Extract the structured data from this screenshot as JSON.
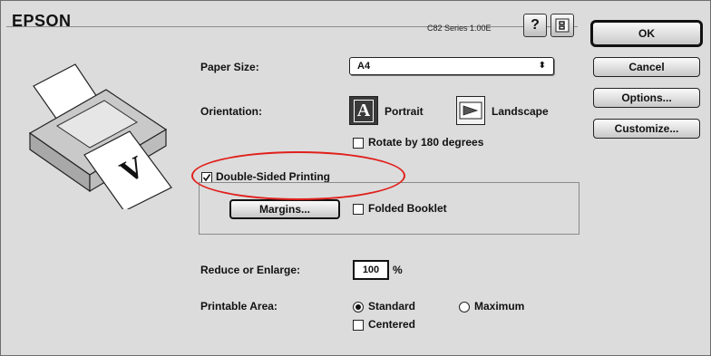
{
  "header": {
    "brand": "EPSON",
    "version": "C82 Series 1.00E",
    "help_label": "?"
  },
  "buttons": {
    "ok": "OK",
    "cancel": "Cancel",
    "options": "Options...",
    "customize": "Customize..."
  },
  "paper_size": {
    "label": "Paper Size:",
    "value": "A4"
  },
  "orientation": {
    "label": "Orientation:",
    "portrait_label": "Portrait",
    "landscape_label": "Landscape",
    "selected": "Portrait",
    "portrait_glyph": "A"
  },
  "rotate": {
    "label": "Rotate by 180 degrees",
    "checked": false
  },
  "double_sided": {
    "label": "Double-Sided Printing",
    "checked": true,
    "margins_label": "Margins...",
    "folded_booklet_label": "Folded Booklet",
    "folded_booklet_checked": false
  },
  "reduce_enlarge": {
    "label": "Reduce or Enlarge:",
    "value": "100",
    "unit": "%"
  },
  "printable_area": {
    "label": "Printable Area:",
    "standard_label": "Standard",
    "maximum_label": "Maximum",
    "selected": "Standard",
    "centered_label": "Centered",
    "centered_checked": false
  },
  "colors": {
    "dialog_bg": "#dcdcdc",
    "annotation": "#e0201c"
  }
}
